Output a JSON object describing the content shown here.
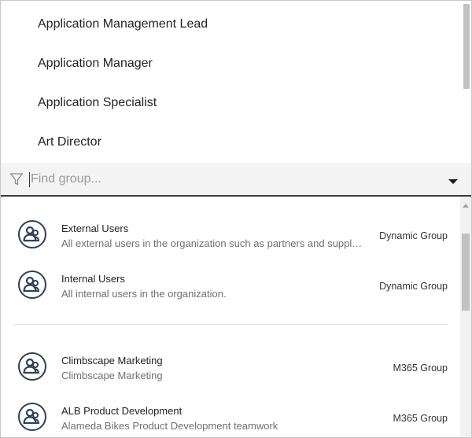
{
  "title_list": {
    "items": [
      {
        "label": "Application Management Lead"
      },
      {
        "label": "Application Manager"
      },
      {
        "label": "Application Specialist"
      },
      {
        "label": "Art Director"
      }
    ]
  },
  "search": {
    "placeholder": "Find group...",
    "value": "",
    "filter_icon": "filter-icon",
    "dropdown_icon": "chevron-down-icon"
  },
  "groups": [
    {
      "name": "External Users",
      "description": "All external users in the organization such as partners and suppliers.",
      "type": "Dynamic Group",
      "icon": "group-icon"
    },
    {
      "name": "Internal Users",
      "description": "All internal users in the organization.",
      "type": "Dynamic Group",
      "icon": "group-icon"
    },
    {
      "name": "Climbscape Marketing",
      "description": "Climbscape Marketing",
      "type": "M365 Group",
      "icon": "group-icon"
    },
    {
      "name": "ALB Product Development",
      "description": "Alameda Bikes Product Development teamwork",
      "type": "M365 Group",
      "icon": "group-icon"
    }
  ],
  "colors": {
    "accent_border": "#3b3b3b",
    "avatar_stroke": "#2f3f55",
    "search_bg": "#f4f4f4"
  }
}
